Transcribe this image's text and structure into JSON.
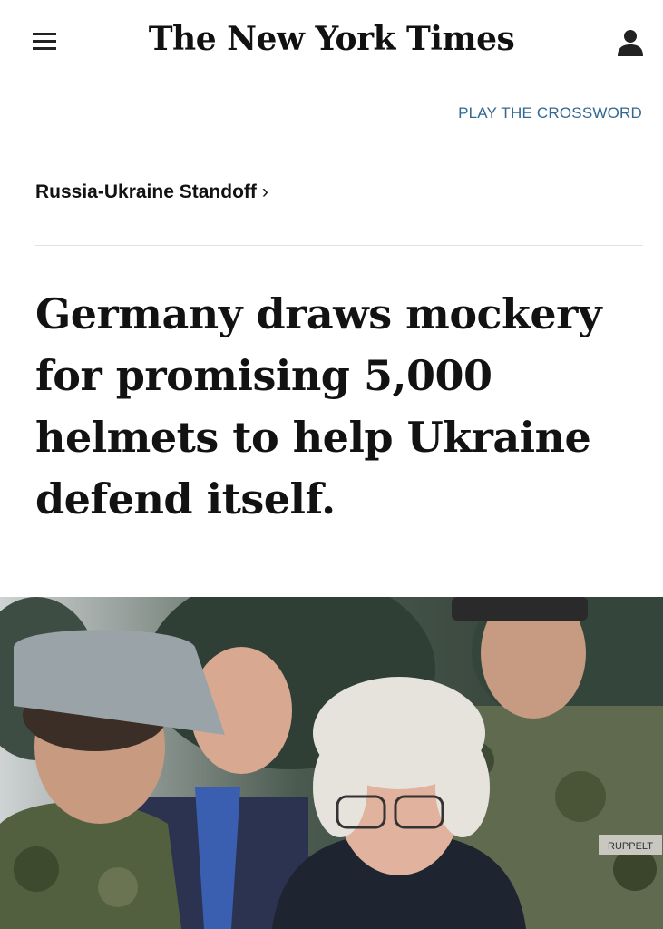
{
  "header": {
    "logo_text": "The New York Times",
    "menu_icon": "hamburger-menu-icon",
    "account_icon": "user-account-icon"
  },
  "crossword": {
    "label": "PLAY THE CROSSWORD"
  },
  "section": {
    "label": "Russia-Ukraine Standoff",
    "chevron": "›"
  },
  "article": {
    "headline": "Germany draws mockery for promising 5,000 helmets to help Ukraine defend itself.",
    "photo_name_tag": "RUPPELT"
  },
  "colors": {
    "link_blue": "#326891",
    "text": "#121212",
    "divider": "#e2e2e2"
  }
}
